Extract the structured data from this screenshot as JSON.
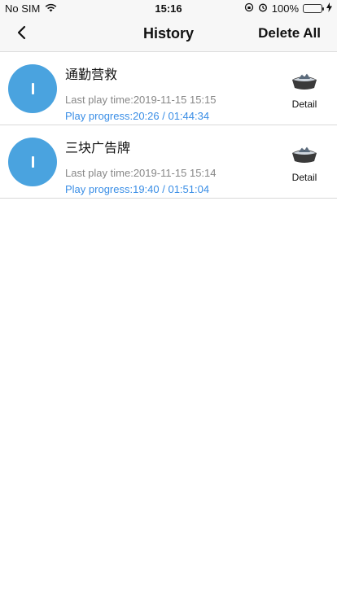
{
  "status_bar": {
    "carrier": "No SIM",
    "time": "15:16",
    "battery": "100%"
  },
  "nav": {
    "title": "History",
    "delete_all_label": "Delete All"
  },
  "items": [
    {
      "title": "通勤营救",
      "last_play": "Last play time:2019-11-15 15:15",
      "progress": "Play progress:20:26 / 01:44:34",
      "detail_label": "Detail"
    },
    {
      "title": "三块广告牌",
      "last_play": "Last play time:2019-11-15 15:14",
      "progress": "Play progress:19:40 / 01:51:04",
      "detail_label": "Detail"
    }
  ],
  "colors": {
    "accent": "#3a8ee6",
    "avatar": "#4aa3df"
  }
}
